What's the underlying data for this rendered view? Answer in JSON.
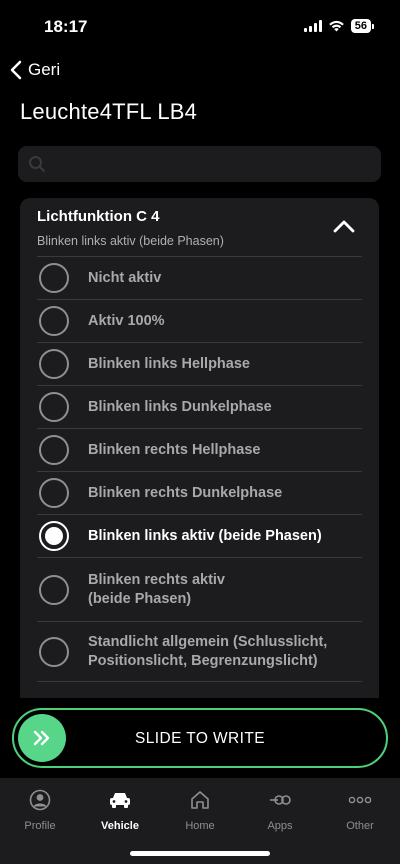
{
  "status": {
    "time": "18:17",
    "battery": "56"
  },
  "nav": {
    "back_label": "Geri"
  },
  "page": {
    "title": "Leuchte4TFL LB4"
  },
  "search": {
    "placeholder": ""
  },
  "card": {
    "title": "Lichtfunktion C 4",
    "selected_value": "Blinken links aktiv (beide Phasen)",
    "options": [
      {
        "label": "Nicht aktiv",
        "selected": false
      },
      {
        "label": "Aktiv 100%",
        "selected": false
      },
      {
        "label": "Blinken links Hellphase",
        "selected": false
      },
      {
        "label": "Blinken links Dunkelphase",
        "selected": false
      },
      {
        "label": "Blinken rechts Hellphase",
        "selected": false
      },
      {
        "label": "Blinken rechts Dunkelphase",
        "selected": false
      },
      {
        "label": "Blinken links aktiv (beide Phasen)",
        "selected": true
      },
      {
        "label": "Blinken rechts aktiv\n(beide Phasen)",
        "selected": false
      },
      {
        "label": "Standlicht allgemein (Schlusslicht,\nPositionslicht, Begrenzungslicht)",
        "selected": false
      },
      {
        "label": "",
        "selected": false
      }
    ]
  },
  "slider": {
    "label": "SLIDE TO WRITE"
  },
  "tabbar": {
    "items": [
      {
        "label": "Profile",
        "icon": "profile-icon",
        "active": false
      },
      {
        "label": "Vehicle",
        "icon": "car-icon",
        "active": true
      },
      {
        "label": "Home",
        "icon": "home-icon",
        "active": false
      },
      {
        "label": "Apps",
        "icon": "apps-icon",
        "active": false
      },
      {
        "label": "Other",
        "icon": "more-icon",
        "active": false
      }
    ]
  },
  "colors": {
    "accent": "#57d68a",
    "slider_border": "#4ecf7a",
    "background": "#000000",
    "card": "#1c1c1e"
  }
}
